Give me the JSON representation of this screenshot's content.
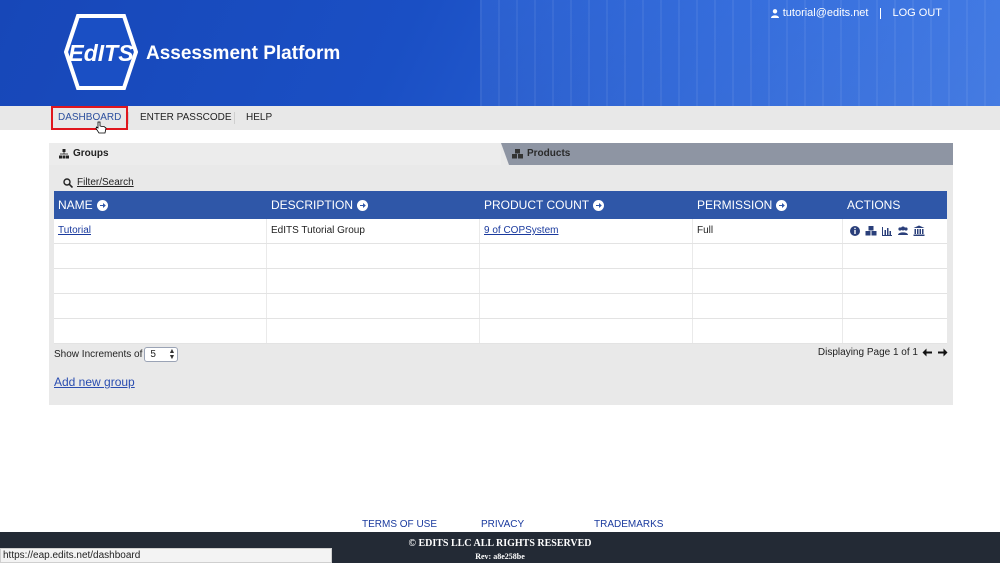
{
  "header": {
    "logo_text": "EdITS",
    "title": "Assessment Platform",
    "user_email": "tutorial@edits.net",
    "logout_label": "LOG OUT"
  },
  "nav": {
    "items": [
      {
        "label": "DASHBOARD",
        "active": true
      },
      {
        "label": "ENTER PASSCODE",
        "active": false
      },
      {
        "label": "HELP",
        "active": false
      }
    ]
  },
  "tabs": {
    "groups_label": "Groups",
    "products_label": "Products"
  },
  "filter_label": "Filter/Search",
  "table": {
    "columns": [
      "NAME",
      "DESCRIPTION",
      "PRODUCT COUNT",
      "PERMISSION",
      "ACTIONS"
    ],
    "rows": [
      {
        "name": "Tutorial",
        "description": "EdITS Tutorial Group",
        "product_count": "9 of COPSystem",
        "permission": "Full"
      }
    ],
    "action_icons": [
      "info-icon",
      "products-icon",
      "chart-icon",
      "users-icon",
      "institution-icon"
    ]
  },
  "pagination": {
    "increments_label": "Show Increments of",
    "increments_value": "5",
    "displaying_label": "Displaying Page 1 of 1"
  },
  "add_group_label": "Add new group",
  "footer": {
    "links": [
      "TERMS OF USE",
      "PRIVACY",
      "TRADEMARKS"
    ],
    "copyright": "© EDITS LLC ALL RIGHTS RESERVED",
    "revision": "Rev: a8e258be"
  },
  "status_bar_url": "https://eap.edits.net/dashboard",
  "colors": {
    "header_blue": "#1a4fc4",
    "table_header": "#2f57a8",
    "active_outline": "#e0161d",
    "footer_bg": "#232a35"
  }
}
